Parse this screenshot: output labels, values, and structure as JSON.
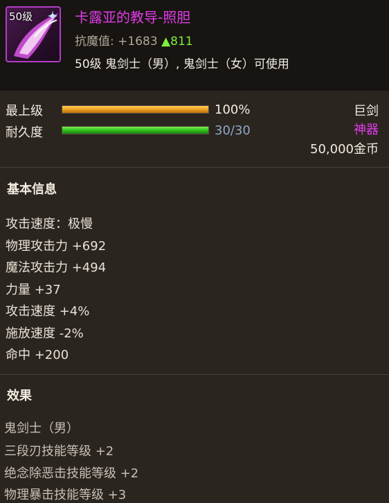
{
  "item": {
    "level_badge": "50级",
    "name": "卡露亚的教导-照胆",
    "resist_label": "抗魔值:",
    "resist_value": "+1683",
    "resist_up": "▲811",
    "usable_by": "50级 鬼剑士（男）, 鬼剑士（女）可使用",
    "icon": "purple-blade-icon"
  },
  "bars": [
    {
      "label": "最上级",
      "fill": 1.0,
      "value": "100%",
      "color": "#f0a020",
      "value_color": "#f2ece0"
    },
    {
      "label": "耐久度",
      "fill": 1.0,
      "value": "30/30",
      "color": "#30c020",
      "value_color": "#8fa8c8"
    }
  ],
  "meta": {
    "type": "巨剑",
    "rarity": "神器",
    "rarity_color": "#e03ce8",
    "price": "50,000金币"
  },
  "basic_info": {
    "title": "基本信息",
    "stats": [
      "攻击速度：极慢",
      "物理攻击力 +692",
      "魔法攻击力 +494",
      "力量 +37",
      "攻击速度 +4%",
      "施放速度 -2%",
      "命中 +200"
    ]
  },
  "effects": {
    "title": "效果",
    "lines": [
      "鬼剑士（男）",
      "三段刃技能等级 +2",
      "绝念除恶击技能等级 +2",
      "物理暴击技能等级 +3"
    ]
  }
}
